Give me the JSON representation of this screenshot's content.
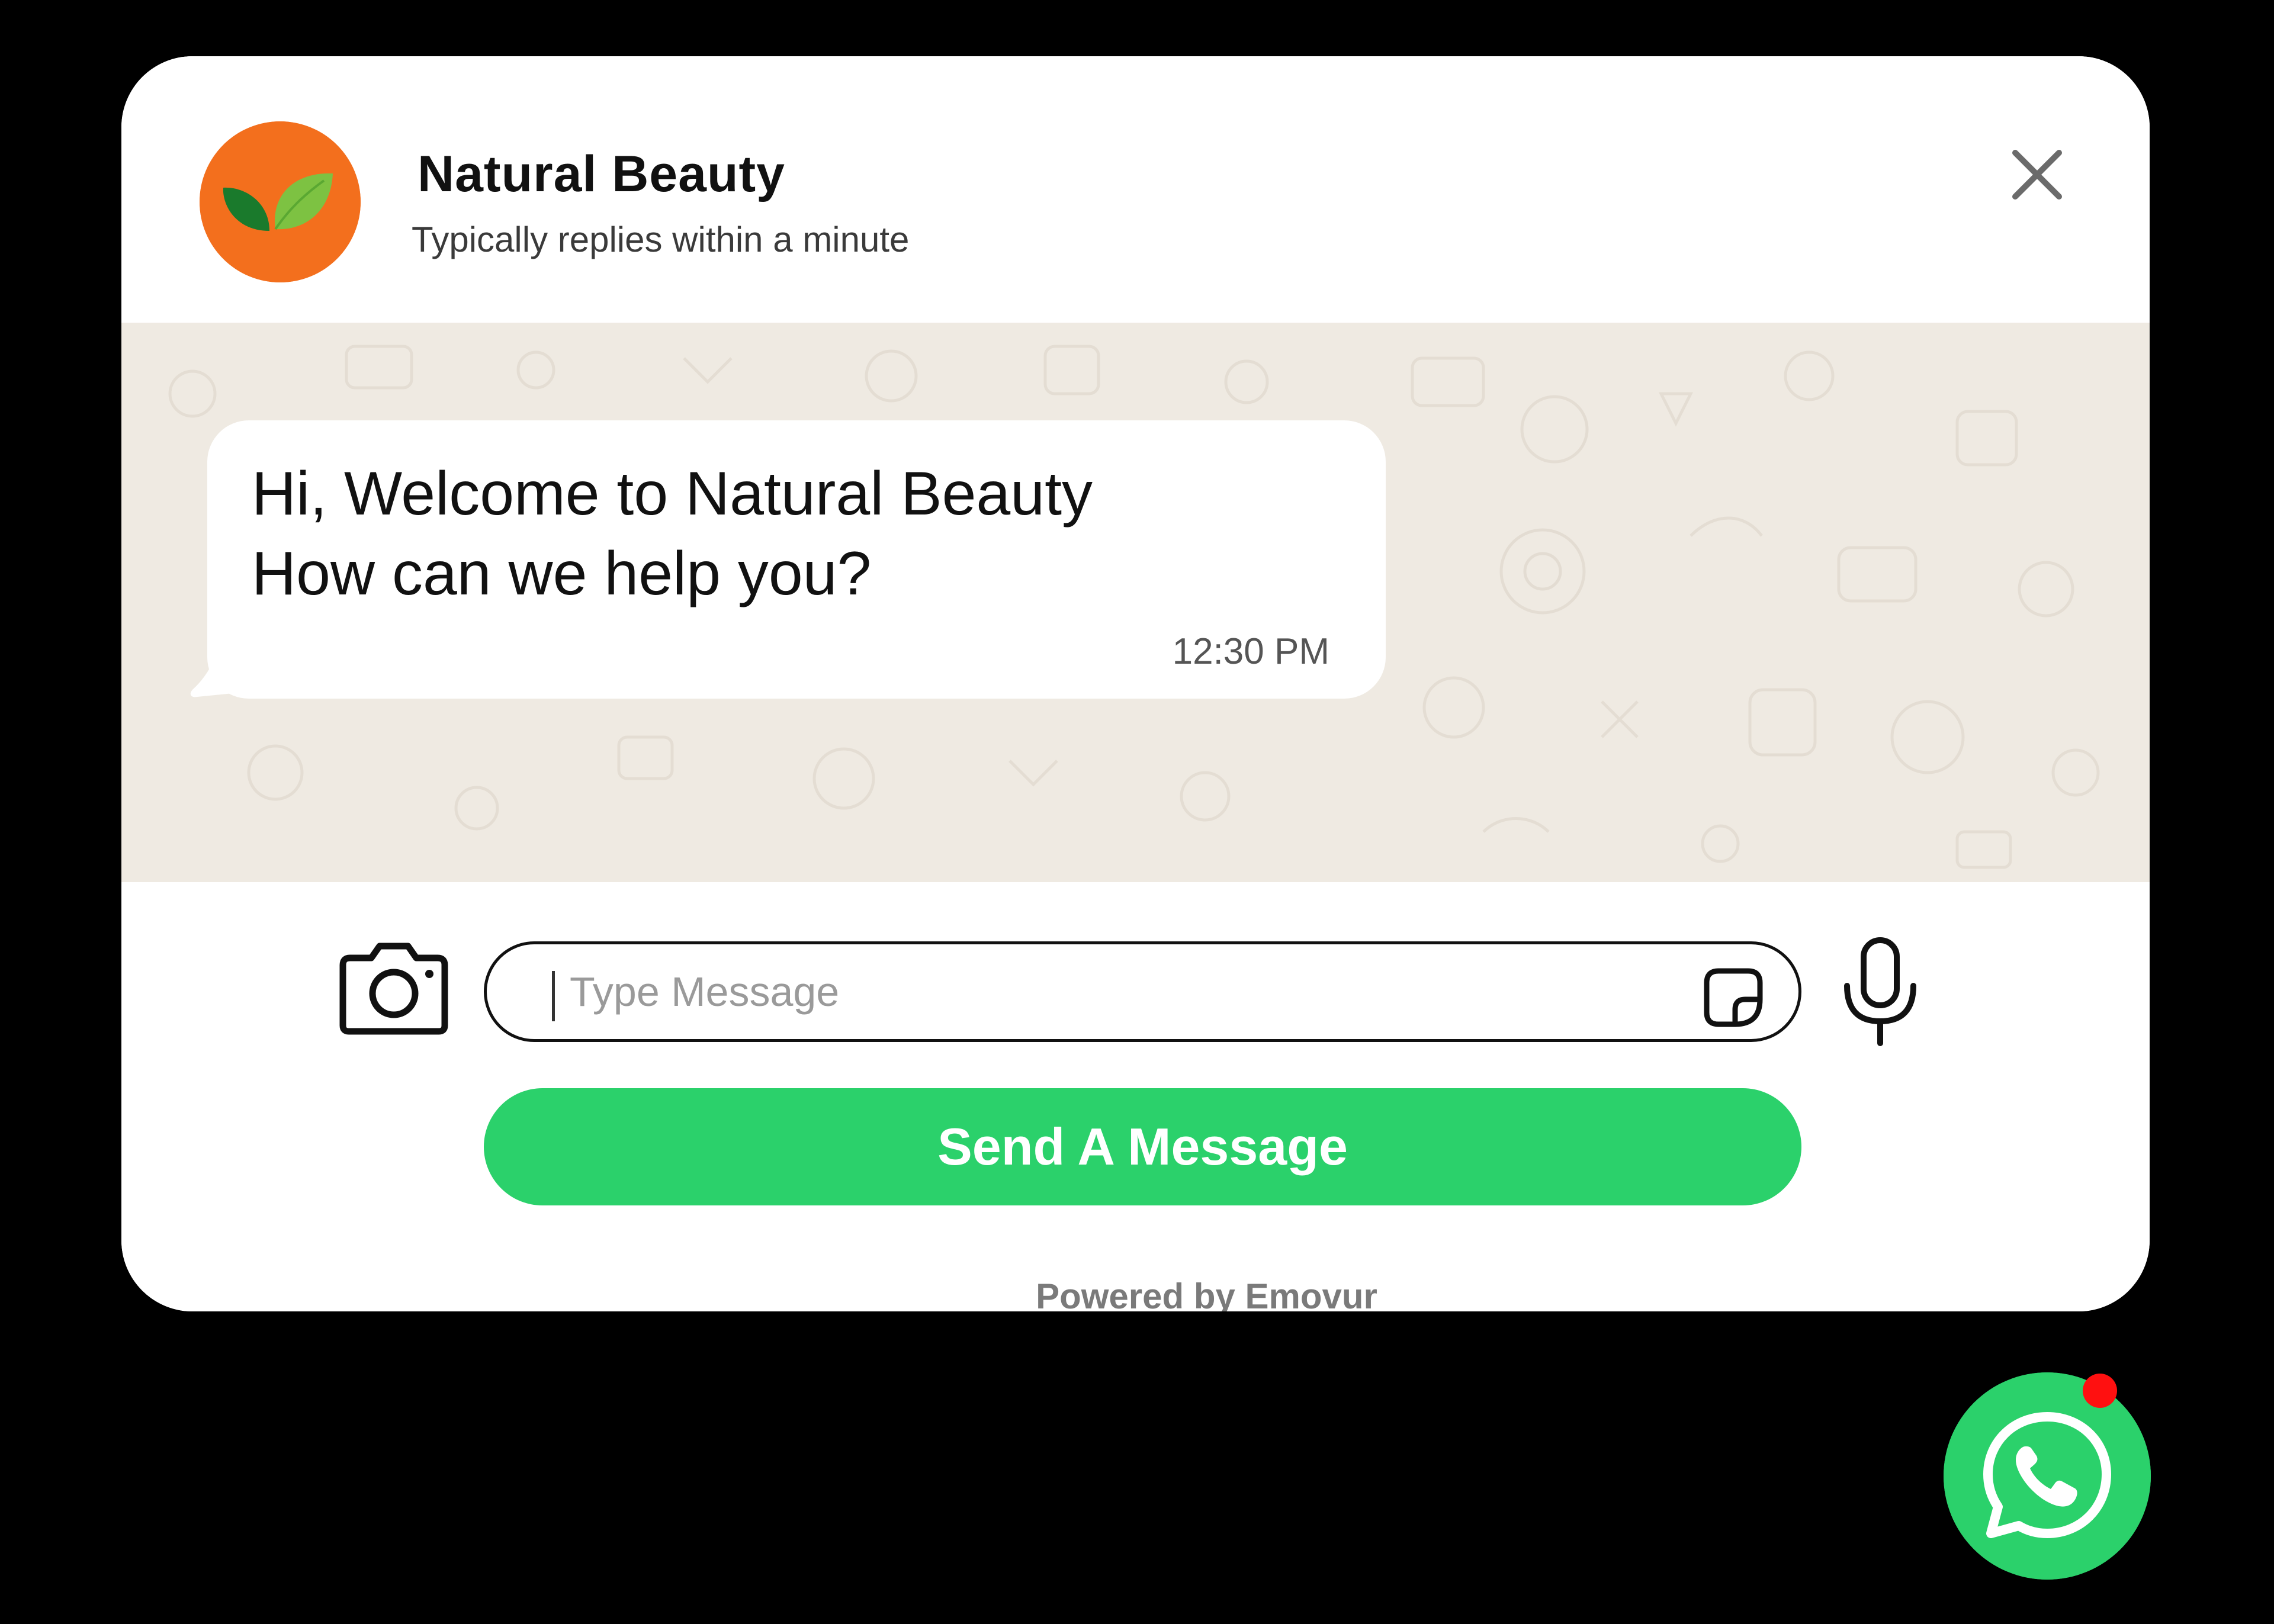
{
  "header": {
    "brand_name": "Natural Beauty",
    "status": "Typically replies within a minute",
    "avatar_icon": "leaf-logo-icon",
    "close_icon": "close-icon"
  },
  "chat": {
    "messages": [
      {
        "lines": [
          "Hi, Welcome to Natural Beauty",
          "How can we help you?"
        ],
        "time": "12:30 PM"
      }
    ],
    "background_color": "#efeae2"
  },
  "composer": {
    "camera_icon": "camera-icon",
    "input_placeholder": "Type Message",
    "input_value": "",
    "sticker_icon": "sticker-icon",
    "mic_icon": "microphone-icon",
    "send_label": "Send A Message",
    "powered_by": "Powered by Emovur"
  },
  "launcher": {
    "icon": "whatsapp-icon",
    "has_notification": true
  },
  "colors": {
    "accent": "#2bd16b",
    "avatar_bg": "#f36f1d",
    "notification": "#ff1010",
    "page_bg": "#000000"
  }
}
